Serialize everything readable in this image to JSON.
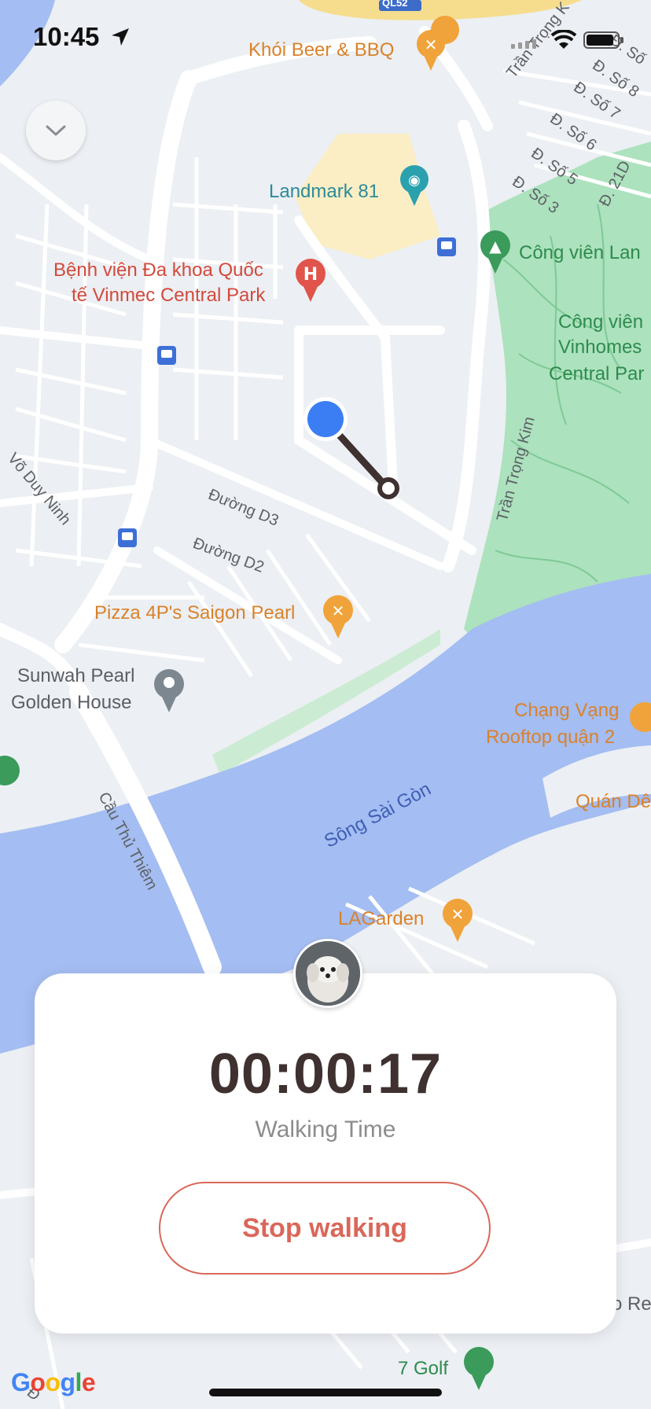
{
  "status_bar": {
    "time": "10:45"
  },
  "map": {
    "road_badge": "QL52",
    "pois": {
      "khoi_beer": "Khói Beer & BBQ",
      "landmark81": "Landmark 81",
      "vinmec_line1": "Bệnh viện Đa khoa Quốc",
      "vinmec_line2": "tế Vinmec Central Park",
      "cong_vien_lan": "Công viên Lan",
      "vinhomes_line1": "Công viên",
      "vinhomes_line2": "Vinhomes",
      "vinhomes_line3": "Central Par",
      "pizza4p": "Pizza 4P's Saigon Pearl",
      "sunwah_line1": "Sunwah Pearl",
      "sunwah_line2": "Golden House",
      "chang_vang_line1": "Chạng Vạng",
      "chang_vang_line2": "Rooftop quận 2",
      "quan_de": "Quán Dê",
      "lagarden": "LAGarden",
      "seven_golf": "7 Golf",
      "o_re": "o Re"
    },
    "streets": {
      "tran_trong_kim_top": "Trần Trọng K",
      "so8": "Đ. Số 8",
      "so7": "Đ. Số 7",
      "so6": "Đ. Số 6",
      "so5": "Đ. Số 5",
      "so3": "Đ. Số 3",
      "so21d": "Đ. 21D",
      "so_top": "Đ. Số",
      "vo_duy_ninh": "Võ Duy Ninh",
      "duong_d3": "Đường D3",
      "duong_d2": "Đường D2",
      "tran_trong_kim": "Trần Trọng Kim",
      "cau_thu_thiem": "Cầu Thủ Thiêm",
      "d_bottom": "Đ"
    },
    "river": "Sông Sài Gòn",
    "colors": {
      "water": "#a4bdf2",
      "park": "#ace2bd",
      "land": "#eceff3",
      "road": "#ffffff",
      "dot": "#3b7ef4",
      "trail": "#3e3130"
    }
  },
  "walk_card": {
    "timer": "00:00:17",
    "timer_label": "Walking Time",
    "stop_label": "Stop walking",
    "accent": "#d9675a"
  },
  "google_logo": {
    "g1": "G",
    "o1": "o",
    "o2": "o",
    "g2": "g",
    "l": "l",
    "e": "e"
  }
}
